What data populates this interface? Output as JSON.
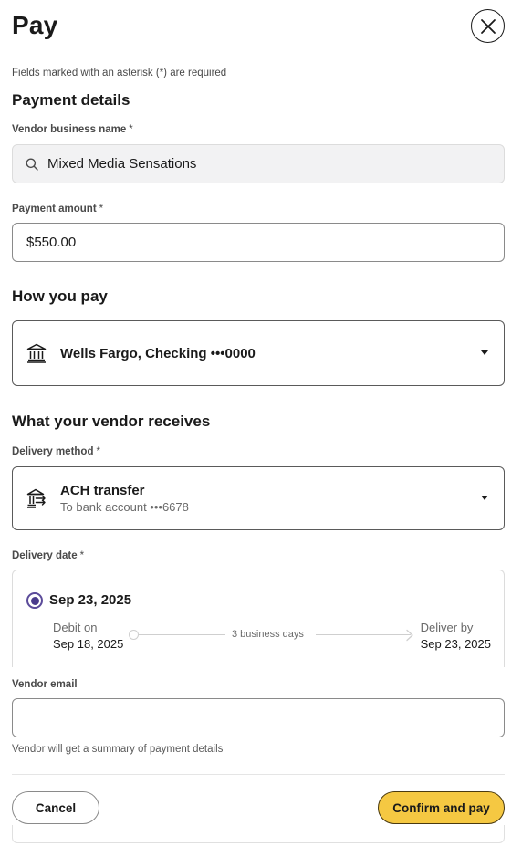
{
  "header": {
    "title": "Pay",
    "close_icon": "close-icon"
  },
  "form": {
    "required_note": "Fields marked with an asterisk (*) are required",
    "asterisk": "*",
    "payment_details": {
      "heading": "Payment details",
      "vendor_label": "Vendor business name",
      "vendor_value": "Mixed Media Sensations",
      "amount_label": "Payment amount",
      "amount_value": "$550.00"
    },
    "how_you_pay": {
      "heading": "How you pay",
      "account": "Wells Fargo, Checking •••0000",
      "icon": "bank-icon"
    },
    "vendor_receives": {
      "heading": "What your vendor receives",
      "method_label": "Delivery method",
      "method_main": "ACH transfer",
      "method_sub": "To bank account •••6678",
      "method_icon": "bank-transfer-icon",
      "date_label": "Delivery date",
      "date_option": "Sep 23, 2025",
      "debit_label": "Debit on",
      "debit_date": "Sep 18, 2025",
      "business_days": "3 business days",
      "deliver_label": "Deliver by",
      "deliver_date": "Sep 23, 2025"
    },
    "vendor_email": {
      "label": "Vendor email",
      "value": "",
      "helper": "Vendor will get a summary of payment details"
    }
  },
  "footer": {
    "cancel_label": "Cancel",
    "confirm_label": "Confirm and pay"
  },
  "colors": {
    "accent_yellow": "#f5c842",
    "radio_purple": "#4a3b8c"
  }
}
